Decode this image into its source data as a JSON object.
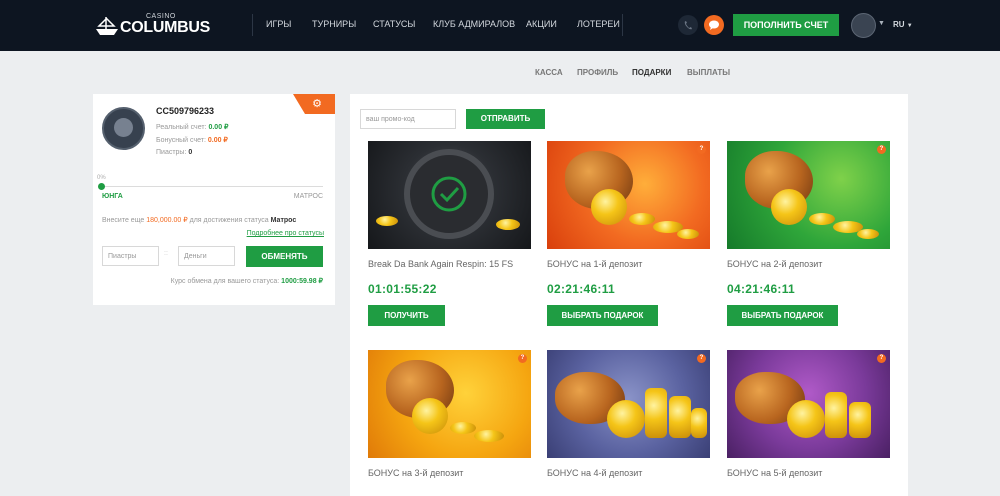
{
  "header": {
    "logo_small": "CASINO",
    "logo_name": "COLUMBUS",
    "nav": [
      "ИГРЫ",
      "ТУРНИРЫ",
      "СТАТУСЫ",
      "КЛУБ АДМИРАЛОВ",
      "АКЦИИ",
      "ЛОТЕРЕИ"
    ],
    "deposit_label": "ПОПОЛНИТЬ СЧЕТ",
    "language": "RU"
  },
  "subnav": [
    "КАССА",
    "ПРОФИЛЬ",
    "ПОДАРКИ",
    "ВЫПЛАТЫ"
  ],
  "profile": {
    "user_id": "CC509796233",
    "real_label": "Реальный счет:",
    "real_value": "0.00 ₽",
    "bonus_label": "Бонусный счет:",
    "bonus_value": "0.00 ₽",
    "piastres_label": "Пиастры:",
    "piastres_value": "0",
    "progress_pct": "0%",
    "progress_fraction": 0,
    "rank_current": "ЮНГА",
    "rank_next": "МАТРОС",
    "status_prefix": "Внесите еще",
    "status_amount": "180,000.00 ₽",
    "status_middle": "для достижения статуса",
    "status_rank": "Матрос",
    "more_link": "Подробнее про статусы",
    "piastres_placeholder": "Пиастры",
    "money_placeholder": "Деньги",
    "exchange_label": "ОБМЕНЯТЬ",
    "rate_label": "Курс обмена для вашего статуса:",
    "rate_value": "1000:59.98 ₽"
  },
  "promo": {
    "placeholder": "ваш промо-код",
    "submit_label": "ОТПРАВИТЬ"
  },
  "gifts": [
    {
      "title": "Break Da Bank Again Respin: 15 FS",
      "timer": "01:01:55:22",
      "button": "ПОЛУЧИТЬ"
    },
    {
      "title": "БОНУС на 1-й депозит",
      "timer": "02:21:46:11",
      "button": "ВЫБРАТЬ ПОДАРОК"
    },
    {
      "title": "БОНУС на 2-й депозит",
      "timer": "04:21:46:11",
      "button": "ВЫБРАТЬ ПОДАРОК"
    },
    {
      "title": "БОНУС на 3-й депозит"
    },
    {
      "title": "БОНУС на 4-й депозит"
    },
    {
      "title": "БОНУС на 5-й депозит"
    }
  ],
  "colors": {
    "accent_green": "#1f9d43",
    "accent_orange": "#f26a21",
    "header_bg": "#0d1521"
  }
}
